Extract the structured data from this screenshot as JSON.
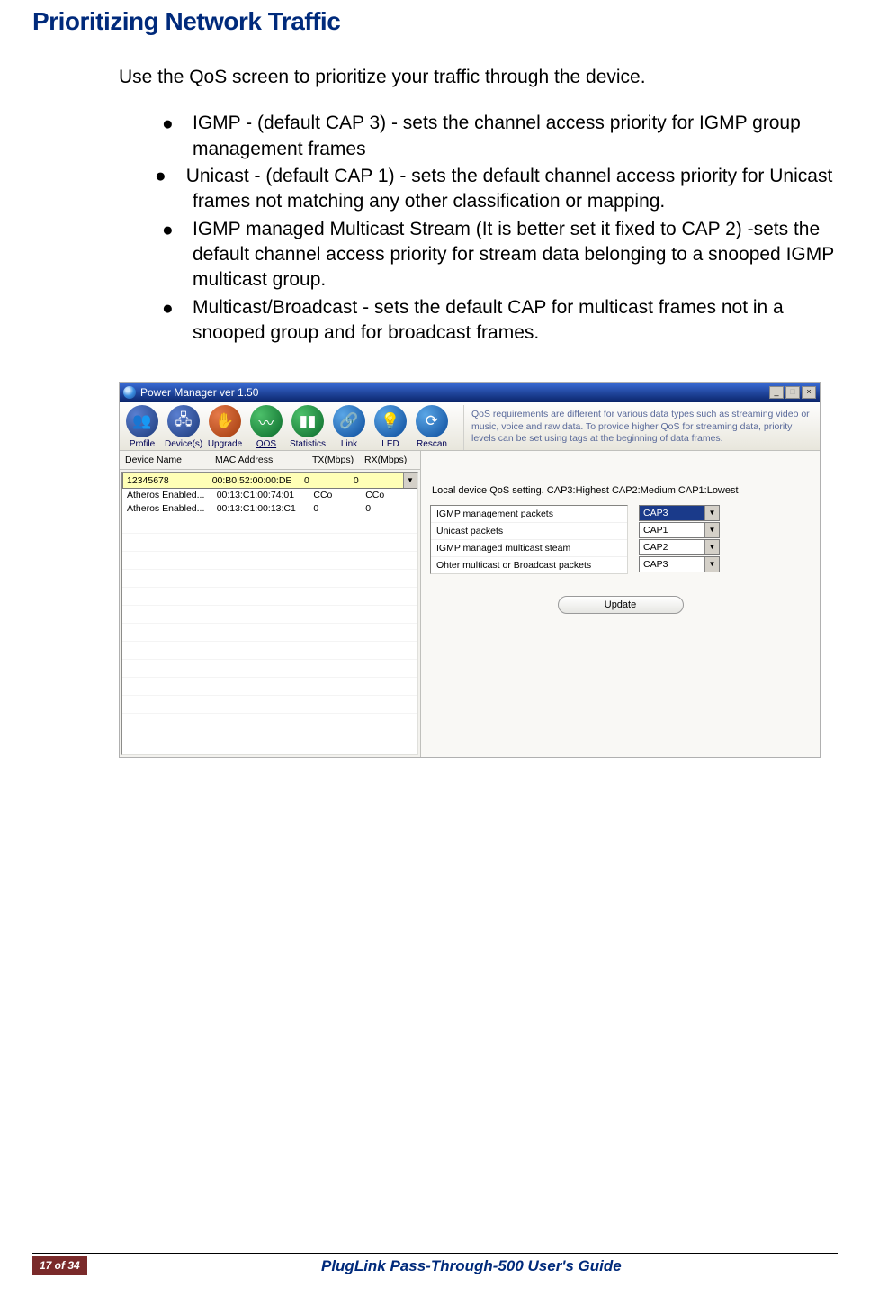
{
  "doc": {
    "heading": "Prioritizing Network Traffic",
    "intro": "Use the QoS screen to prioritize your traffic through the device.",
    "bullets": [
      "IGMP - (default CAP 3) - sets the channel access priority for IGMP group management frames",
      "Unicast - (default CAP 1) - sets the default channel access priority for Unicast frames not matching any other classification or mapping.",
      "IGMP managed Multicast Stream (It is better set it fixed to CAP 2) -sets the default channel access priority for stream data belonging to a snooped IGMP multicast group.",
      "Multicast/Broadcast - sets the default CAP for multicast frames not in a snooped group and for broadcast frames."
    ]
  },
  "app": {
    "title": "Power Manager ver 1.50",
    "toolbar": {
      "profile": "Profile",
      "devices": "Device(s)",
      "upgrade": "Upgrade",
      "qos": "QOS",
      "statistics": "Statistics",
      "link": "Link",
      "led": "LED",
      "rescan": "Rescan"
    },
    "desc": "QoS requirements are different for various data types such as streaming video or music, voice and raw data. To provide higher QoS for streaming data, priority levels can be set using tags at the beginning of data frames.",
    "columns": {
      "name": "Device Name",
      "mac": "MAC Address",
      "tx": "TX(Mbps)",
      "rx": "RX(Mbps)"
    },
    "devices": [
      {
        "name": "12345678",
        "mac": "00:B0:52:00:00:DE",
        "tx": "0",
        "rx": "0",
        "selected": true
      },
      {
        "name": "Atheros Enabled...",
        "mac": "00:13:C1:00:74:01",
        "tx": "CCo",
        "rx": "CCo",
        "selected": false
      },
      {
        "name": "Atheros Enabled...",
        "mac": "00:13:C1:00:13:C1",
        "tx": "0",
        "rx": "0",
        "selected": false
      }
    ],
    "qos": {
      "caption": "Local device QoS setting. CAP3:Highest CAP2:Medium CAP1:Lowest",
      "rows": [
        {
          "label": "IGMP management packets",
          "value": "CAP3",
          "active": true
        },
        {
          "label": "Unicast packets",
          "value": "CAP1",
          "active": false
        },
        {
          "label": "IGMP managed multicast steam",
          "value": "CAP2",
          "active": false
        },
        {
          "label": "Ohter multicast or Broadcast packets",
          "value": "CAP3",
          "active": false
        }
      ],
      "update": "Update"
    }
  },
  "footer": {
    "page": "17 of 34",
    "title": "PlugLink Pass-Through-500 User's Guide"
  }
}
